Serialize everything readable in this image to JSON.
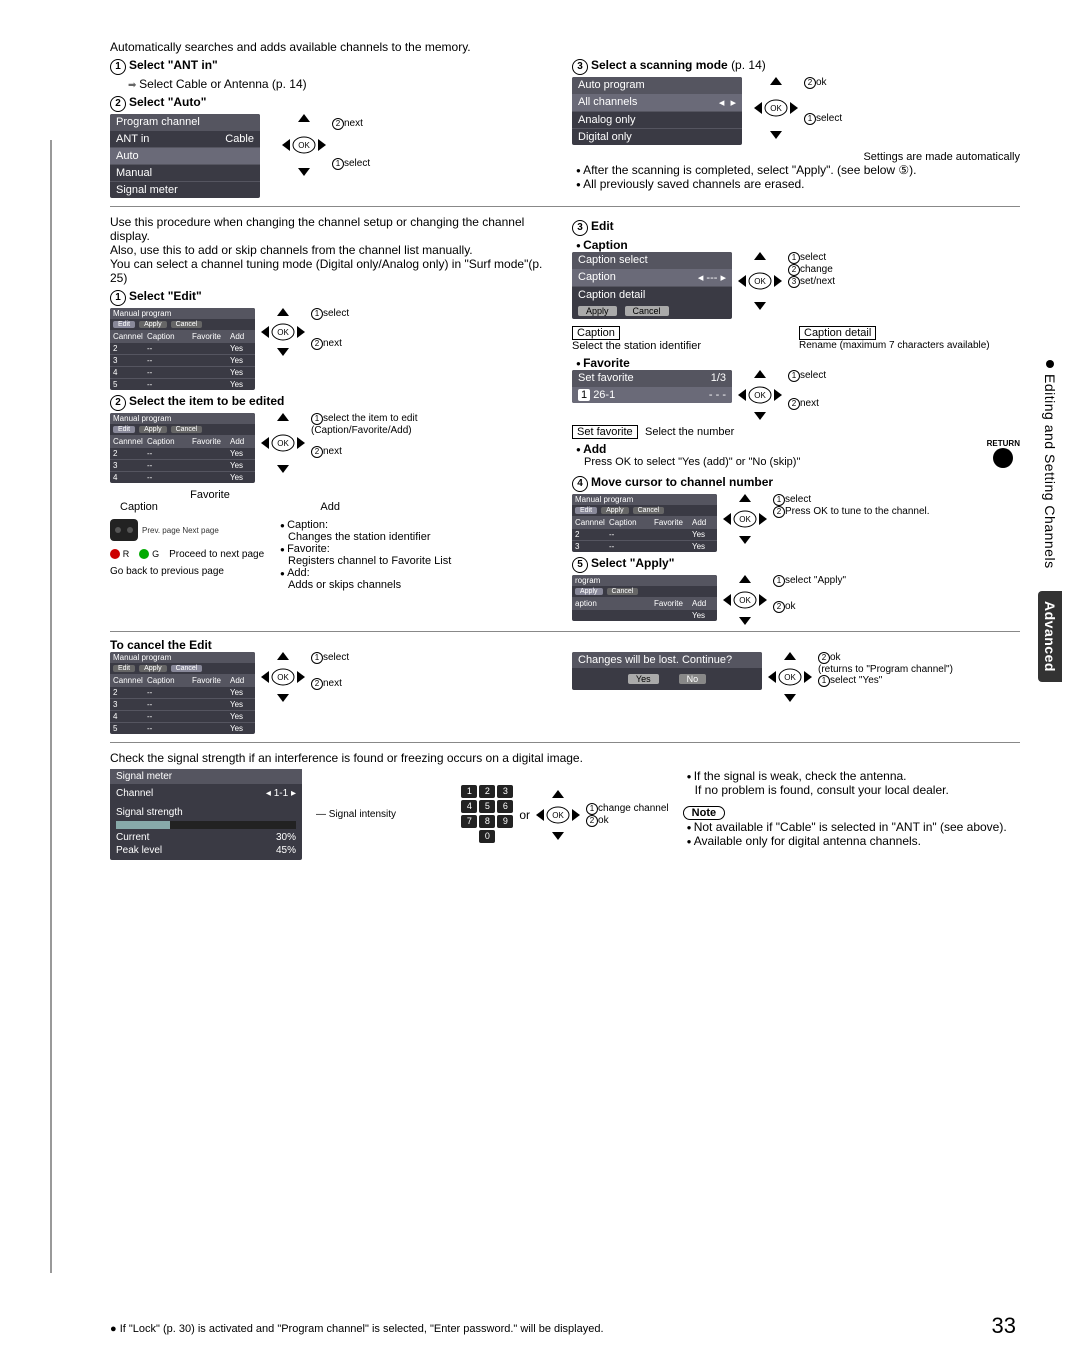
{
  "pageNumber": "33",
  "sideTab1": "Editing and Setting Channels",
  "sideTab2": "Advanced",
  "auto_intro": "Automatically searches and adds available channels to the memory.",
  "s1": "Select \"ANT in\"",
  "s1_sub": "Select Cable or Antenna (p. 14)",
  "s2": "Select \"Auto\"",
  "prog_channel": {
    "title": "Program channel",
    "r1a": "ANT in",
    "r1b": "Cable",
    "r2": "Auto",
    "r3": "Manual",
    "r4": "Signal meter"
  },
  "dp_next": "next",
  "dp_select": "select",
  "dp_ok": "ok",
  "dp_change": "change",
  "dp_setnext": "set/next",
  "dp_selectapply": "select \"Apply\"",
  "dp_selectitem": "select the item to edit",
  "dp_addhint": "(Caption/Favorite/Add)",
  "dp_pressok": "Press OK to tune to the channel.",
  "dp_returns": "(returns to \"Program channel\")",
  "dp_selectyes": "select \"Yes\"",
  "dp_changech": "change channel",
  "ok": "OK",
  "s3": "Select a scanning mode",
  "s3_ref": "(p. 14)",
  "auto_program": {
    "title": "Auto program",
    "r1": "All channels",
    "r2": "Analog only",
    "r3": "Digital only"
  },
  "auto_notes": [
    "Settings are made automatically",
    "After the scanning is completed, select \"Apply\". (see below ⑤).",
    "All previously saved channels are erased."
  ],
  "manual_intro1": "Use this procedure when changing the channel setup or changing the channel display.",
  "manual_intro2": "Also, use this to add or skip channels from the channel list manually.",
  "manual_intro3": "You can select a channel tuning mode (Digital only/Analog only) in \"Surf mode\"(p. 25)",
  "m1": "Select \"Edit\"",
  "m2": "Select the item to be edited",
  "m3": "Edit",
  "caption_h": "Caption",
  "caption_sel": {
    "title": "Caption select",
    "r1a": "Caption",
    "r1b": "---",
    "r2": "Caption detail",
    "r3a": "Apply",
    "r3b": "Cancel"
  },
  "caption_box": "Caption",
  "caption_box_desc": "Select the station identifier",
  "caption_detail_box": "Caption detail",
  "caption_detail_desc": "Rename (maximum 7 characters available)",
  "favorite_h": "Favorite",
  "set_fav": {
    "title": "Set favorite",
    "page": "1/3",
    "num": "1",
    "ch": "26-1",
    "cap": "- - -"
  },
  "set_fav_box": "Set favorite",
  "set_fav_desc": "Select the number",
  "add_h": "Add",
  "add_desc": "Press OK to select \"Yes (add)\" or \"No (skip)\"",
  "return_label": "RETURN",
  "m4": "Move cursor to channel number",
  "m5": "Select \"Apply\"",
  "manual_table": {
    "title": "Manual program",
    "tab1": "Edit",
    "tab2": "Apply",
    "tab3": "Cancel",
    "h1": "Cannnel",
    "h2": "Caption",
    "h3": "Favorite",
    "h4": "Add",
    "yes": "Yes"
  },
  "legend": {
    "favorite": "Favorite",
    "caption": "Caption",
    "add": "Add",
    "caption_d": "Caption:",
    "caption_desc": "Changes the station identifier",
    "favorite_d": "Favorite:",
    "favorite_desc": "Registers channel to Favorite List",
    "add_d": "Add:",
    "add_desc": "Adds or skips channels",
    "proceed": "Proceed to next page",
    "goback": "Go back to previous page",
    "r": "R",
    "g": "G",
    "footer_hint": "Prev. page   Next page"
  },
  "cancel_h": "To cancel the Edit",
  "cancel_dlg": {
    "title": "Changes will be lost. Continue?",
    "yes": "Yes",
    "no": "No"
  },
  "signal_intro": "Check the signal strength if an interference is found or freezing occurs on a digital image.",
  "signal_meter": {
    "title": "Signal  meter",
    "r1a": "Channel",
    "r1b": "1-1",
    "r2": "Signal  strength",
    "r3a": "Current",
    "r3b": "30%",
    "r4a": "Peak level",
    "r4b": "45%"
  },
  "signal_intensity": "Signal intensity",
  "or": "or",
  "signal_notes": [
    "If the signal is weak, check the antenna.",
    "If no problem is found, consult your local dealer."
  ],
  "note_label": "Note",
  "note_items": [
    "Not available if \"Cable\" is selected in \"ANT in\" (see above).",
    "Available only for digital antenna channels."
  ],
  "footer": "If \"Lock\" (p. 30) is activated and \"Program channel\" is selected, \"Enter password.\" will be displayed."
}
